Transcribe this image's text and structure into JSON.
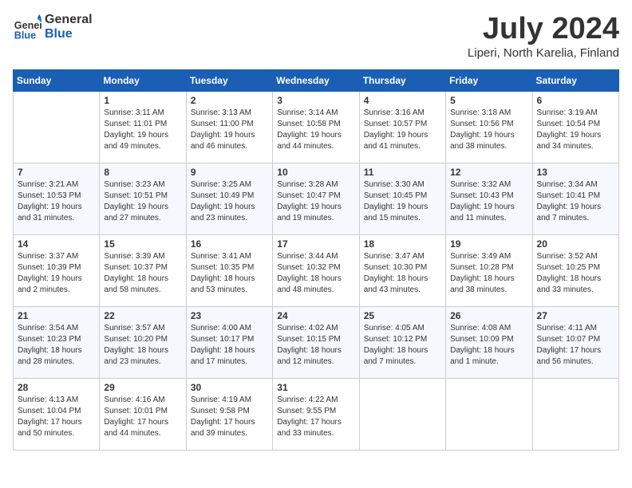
{
  "header": {
    "logo_general": "General",
    "logo_blue": "Blue",
    "month_title": "July 2024",
    "location": "Liperi, North Karelia, Finland"
  },
  "weekdays": [
    "Sunday",
    "Monday",
    "Tuesday",
    "Wednesday",
    "Thursday",
    "Friday",
    "Saturday"
  ],
  "weeks": [
    [
      {
        "day": "",
        "info": ""
      },
      {
        "day": "1",
        "info": "Sunrise: 3:11 AM\nSunset: 11:01 PM\nDaylight: 19 hours\nand 49 minutes."
      },
      {
        "day": "2",
        "info": "Sunrise: 3:13 AM\nSunset: 11:00 PM\nDaylight: 19 hours\nand 46 minutes."
      },
      {
        "day": "3",
        "info": "Sunrise: 3:14 AM\nSunset: 10:58 PM\nDaylight: 19 hours\nand 44 minutes."
      },
      {
        "day": "4",
        "info": "Sunrise: 3:16 AM\nSunset: 10:57 PM\nDaylight: 19 hours\nand 41 minutes."
      },
      {
        "day": "5",
        "info": "Sunrise: 3:18 AM\nSunset: 10:56 PM\nDaylight: 19 hours\nand 38 minutes."
      },
      {
        "day": "6",
        "info": "Sunrise: 3:19 AM\nSunset: 10:54 PM\nDaylight: 19 hours\nand 34 minutes."
      }
    ],
    [
      {
        "day": "7",
        "info": "Sunrise: 3:21 AM\nSunset: 10:53 PM\nDaylight: 19 hours\nand 31 minutes."
      },
      {
        "day": "8",
        "info": "Sunrise: 3:23 AM\nSunset: 10:51 PM\nDaylight: 19 hours\nand 27 minutes."
      },
      {
        "day": "9",
        "info": "Sunrise: 3:25 AM\nSunset: 10:49 PM\nDaylight: 19 hours\nand 23 minutes."
      },
      {
        "day": "10",
        "info": "Sunrise: 3:28 AM\nSunset: 10:47 PM\nDaylight: 19 hours\nand 19 minutes."
      },
      {
        "day": "11",
        "info": "Sunrise: 3:30 AM\nSunset: 10:45 PM\nDaylight: 19 hours\nand 15 minutes."
      },
      {
        "day": "12",
        "info": "Sunrise: 3:32 AM\nSunset: 10:43 PM\nDaylight: 19 hours\nand 11 minutes."
      },
      {
        "day": "13",
        "info": "Sunrise: 3:34 AM\nSunset: 10:41 PM\nDaylight: 19 hours\nand 7 minutes."
      }
    ],
    [
      {
        "day": "14",
        "info": "Sunrise: 3:37 AM\nSunset: 10:39 PM\nDaylight: 19 hours\nand 2 minutes."
      },
      {
        "day": "15",
        "info": "Sunrise: 3:39 AM\nSunset: 10:37 PM\nDaylight: 18 hours\nand 58 minutes."
      },
      {
        "day": "16",
        "info": "Sunrise: 3:41 AM\nSunset: 10:35 PM\nDaylight: 18 hours\nand 53 minutes."
      },
      {
        "day": "17",
        "info": "Sunrise: 3:44 AM\nSunset: 10:32 PM\nDaylight: 18 hours\nand 48 minutes."
      },
      {
        "day": "18",
        "info": "Sunrise: 3:47 AM\nSunset: 10:30 PM\nDaylight: 18 hours\nand 43 minutes."
      },
      {
        "day": "19",
        "info": "Sunrise: 3:49 AM\nSunset: 10:28 PM\nDaylight: 18 hours\nand 38 minutes."
      },
      {
        "day": "20",
        "info": "Sunrise: 3:52 AM\nSunset: 10:25 PM\nDaylight: 18 hours\nand 33 minutes."
      }
    ],
    [
      {
        "day": "21",
        "info": "Sunrise: 3:54 AM\nSunset: 10:23 PM\nDaylight: 18 hours\nand 28 minutes."
      },
      {
        "day": "22",
        "info": "Sunrise: 3:57 AM\nSunset: 10:20 PM\nDaylight: 18 hours\nand 23 minutes."
      },
      {
        "day": "23",
        "info": "Sunrise: 4:00 AM\nSunset: 10:17 PM\nDaylight: 18 hours\nand 17 minutes."
      },
      {
        "day": "24",
        "info": "Sunrise: 4:02 AM\nSunset: 10:15 PM\nDaylight: 18 hours\nand 12 minutes."
      },
      {
        "day": "25",
        "info": "Sunrise: 4:05 AM\nSunset: 10:12 PM\nDaylight: 18 hours\nand 7 minutes."
      },
      {
        "day": "26",
        "info": "Sunrise: 4:08 AM\nSunset: 10:09 PM\nDaylight: 18 hours\nand 1 minute."
      },
      {
        "day": "27",
        "info": "Sunrise: 4:11 AM\nSunset: 10:07 PM\nDaylight: 17 hours\nand 56 minutes."
      }
    ],
    [
      {
        "day": "28",
        "info": "Sunrise: 4:13 AM\nSunset: 10:04 PM\nDaylight: 17 hours\nand 50 minutes."
      },
      {
        "day": "29",
        "info": "Sunrise: 4:16 AM\nSunset: 10:01 PM\nDaylight: 17 hours\nand 44 minutes."
      },
      {
        "day": "30",
        "info": "Sunrise: 4:19 AM\nSunset: 9:58 PM\nDaylight: 17 hours\nand 39 minutes."
      },
      {
        "day": "31",
        "info": "Sunrise: 4:22 AM\nSunset: 9:55 PM\nDaylight: 17 hours\nand 33 minutes."
      },
      {
        "day": "",
        "info": ""
      },
      {
        "day": "",
        "info": ""
      },
      {
        "day": "",
        "info": ""
      }
    ]
  ]
}
